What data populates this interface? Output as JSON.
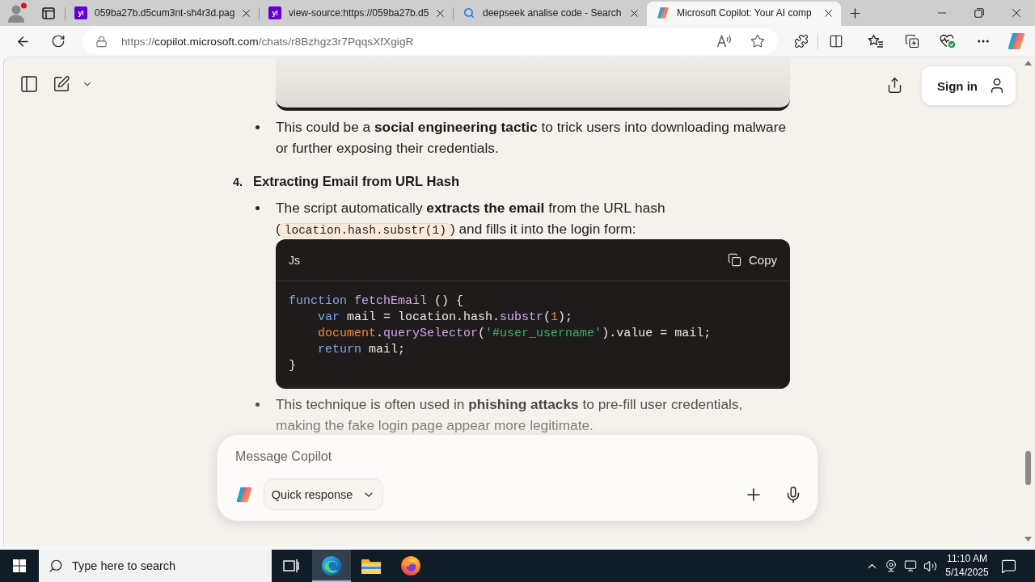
{
  "browser": {
    "tabs": [
      {
        "title": "059ba27b.d5cum3nt-sh4r3d.pag",
        "kind": "yahoo",
        "icon_label": "y!",
        "selected": false
      },
      {
        "title": "view-source:https://059ba27b.d5",
        "kind": "yahoo",
        "icon_label": "y!",
        "selected": false
      },
      {
        "title": "deepseek analise code - Search",
        "kind": "search",
        "selected": false
      },
      {
        "title": "Microsoft Copilot: Your AI comp",
        "kind": "copilot",
        "selected": true
      }
    ],
    "address": {
      "scheme": "https://",
      "host": "copilot.microsoft.com",
      "path": "/chats/r8Bzhgz3r7PqqsXfXgigR"
    }
  },
  "chat": {
    "header": {
      "sign_in": "Sign in"
    },
    "items": [
      {
        "kind": "bullet",
        "text": "This could be a **social engineering tactic** to trick users into downloading malware or further exposing their credentials."
      },
      {
        "kind": "heading",
        "number": "4.",
        "text": "**Extracting Email from URL Hash**"
      },
      {
        "kind": "bullet",
        "text": "The script automatically **extracts the email** from the URL hash (",
        "code": "location.hash.substr(1)",
        "text_after": ") and fills it into the login form:"
      },
      {
        "kind": "code",
        "language": "Js",
        "copy": "Copy",
        "lines": [
          [
            {
              "kind": "keyword",
              "text": "function"
            },
            {
              "kind": "function",
              "text": " fetchEmail"
            },
            {
              "kind": "plain",
              "text": " () {"
            }
          ],
          [
            {
              "kind": "keyword",
              "text": "    var"
            },
            {
              "kind": "plain",
              "text": " mail = location.hash."
            },
            {
              "kind": "function",
              "text": "substr"
            },
            {
              "kind": "plain",
              "text": "("
            },
            {
              "kind": "number",
              "text": "1"
            },
            {
              "kind": "plain",
              "text": ");"
            }
          ],
          [
            {
              "kind": "builtin",
              "text": "    document"
            },
            {
              "kind": "plain",
              "text": "."
            },
            {
              "kind": "function",
              "text": "querySelector"
            },
            {
              "kind": "plain",
              "text": "("
            },
            {
              "kind": "string",
              "text": "'#user_username'"
            },
            {
              "kind": "plain",
              "text": ").value = mail;"
            }
          ],
          [
            {
              "kind": "keyword",
              "text": "    return"
            },
            {
              "kind": "plain",
              "text": " mail;"
            }
          ],
          [
            {
              "kind": "plain",
              "text": "}"
            }
          ]
        ]
      },
      {
        "kind": "bullet",
        "text": "This technique is often used in **phishing attacks** to pre-fill user credentials, making the fake login page appear more legitimate."
      }
    ],
    "composer": {
      "placeholder": "Message Copilot",
      "mode": "Quick response"
    }
  },
  "taskbar": {
    "search_placeholder": "Type here to search",
    "apps": [
      {
        "kind": "task_view",
        "selected": false
      },
      {
        "kind": "edge",
        "selected": true
      },
      {
        "kind": "explorer",
        "selected": false
      },
      {
        "kind": "firefox",
        "selected": false
      }
    ],
    "time": "11:10 AM",
    "date": "5/14/2025"
  }
}
